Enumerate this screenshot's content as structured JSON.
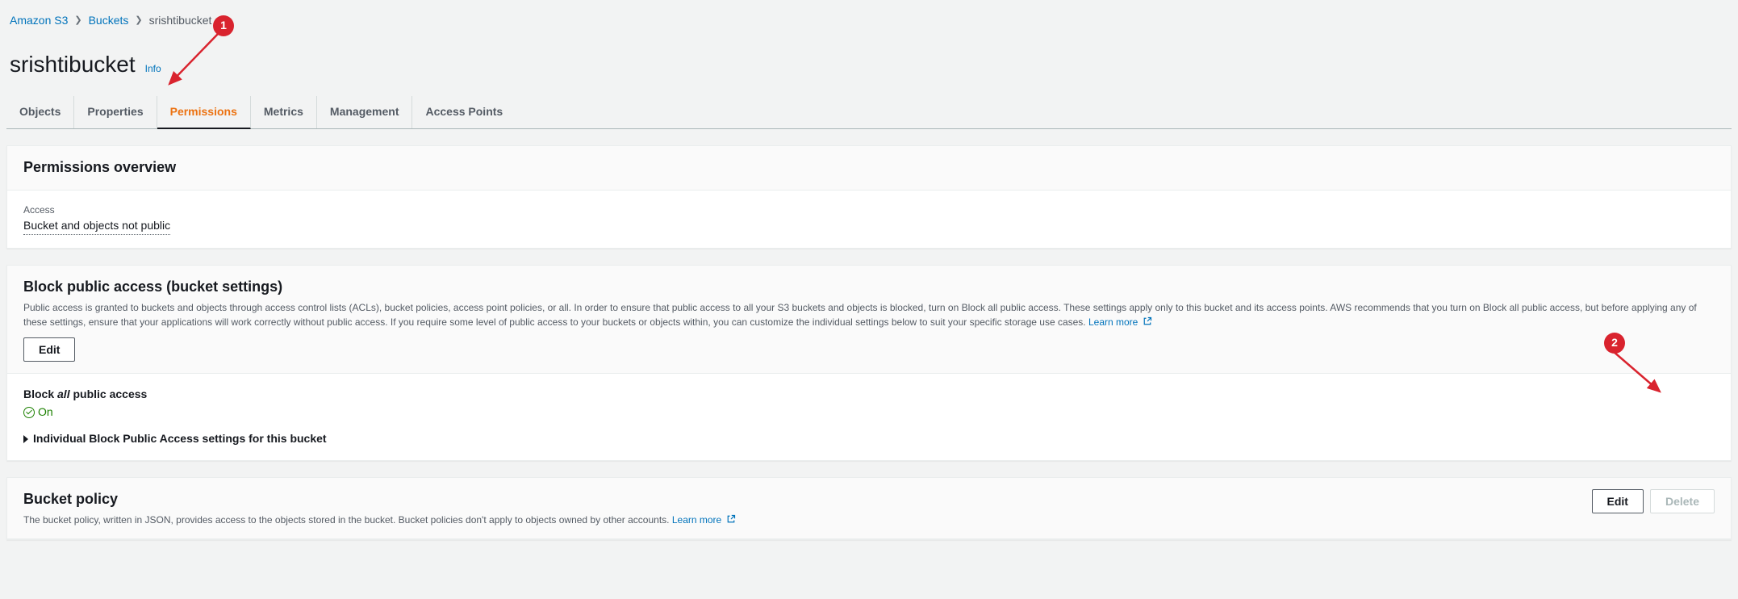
{
  "breadcrumb": {
    "root": "Amazon S3",
    "buckets": "Buckets",
    "current": "srishtibucket"
  },
  "header": {
    "title": "srishtibucket",
    "info": "Info"
  },
  "tabs": [
    {
      "label": "Objects",
      "active": false
    },
    {
      "label": "Properties",
      "active": false
    },
    {
      "label": "Permissions",
      "active": true
    },
    {
      "label": "Metrics",
      "active": false
    },
    {
      "label": "Management",
      "active": false
    },
    {
      "label": "Access Points",
      "active": false
    }
  ],
  "overview": {
    "title": "Permissions overview",
    "access_label": "Access",
    "access_value": "Bucket and objects not public"
  },
  "block_public": {
    "title": "Block public access (bucket settings)",
    "desc": "Public access is granted to buckets and objects through access control lists (ACLs), bucket policies, access point policies, or all. In order to ensure that public access to all your S3 buckets and objects is blocked, turn on Block all public access. These settings apply only to this bucket and its access points. AWS recommends that you turn on Block all public access, but before applying any of these settings, ensure that your applications will work correctly without public access. If you require some level of public access to your buckets or objects within, you can customize the individual settings below to suit your specific storage use cases.",
    "learn_more": "Learn more",
    "edit": "Edit",
    "setting_prefix": "Block ",
    "setting_emph": "all",
    "setting_suffix": " public access",
    "status": "On",
    "expand": "Individual Block Public Access settings for this bucket"
  },
  "bucket_policy": {
    "title": "Bucket policy",
    "desc": "The bucket policy, written in JSON, provides access to the objects stored in the bucket. Bucket policies don't apply to objects owned by other accounts.",
    "learn_more": "Learn more",
    "edit": "Edit",
    "delete": "Delete"
  },
  "annotations": {
    "badge1": "1",
    "badge2": "2"
  }
}
